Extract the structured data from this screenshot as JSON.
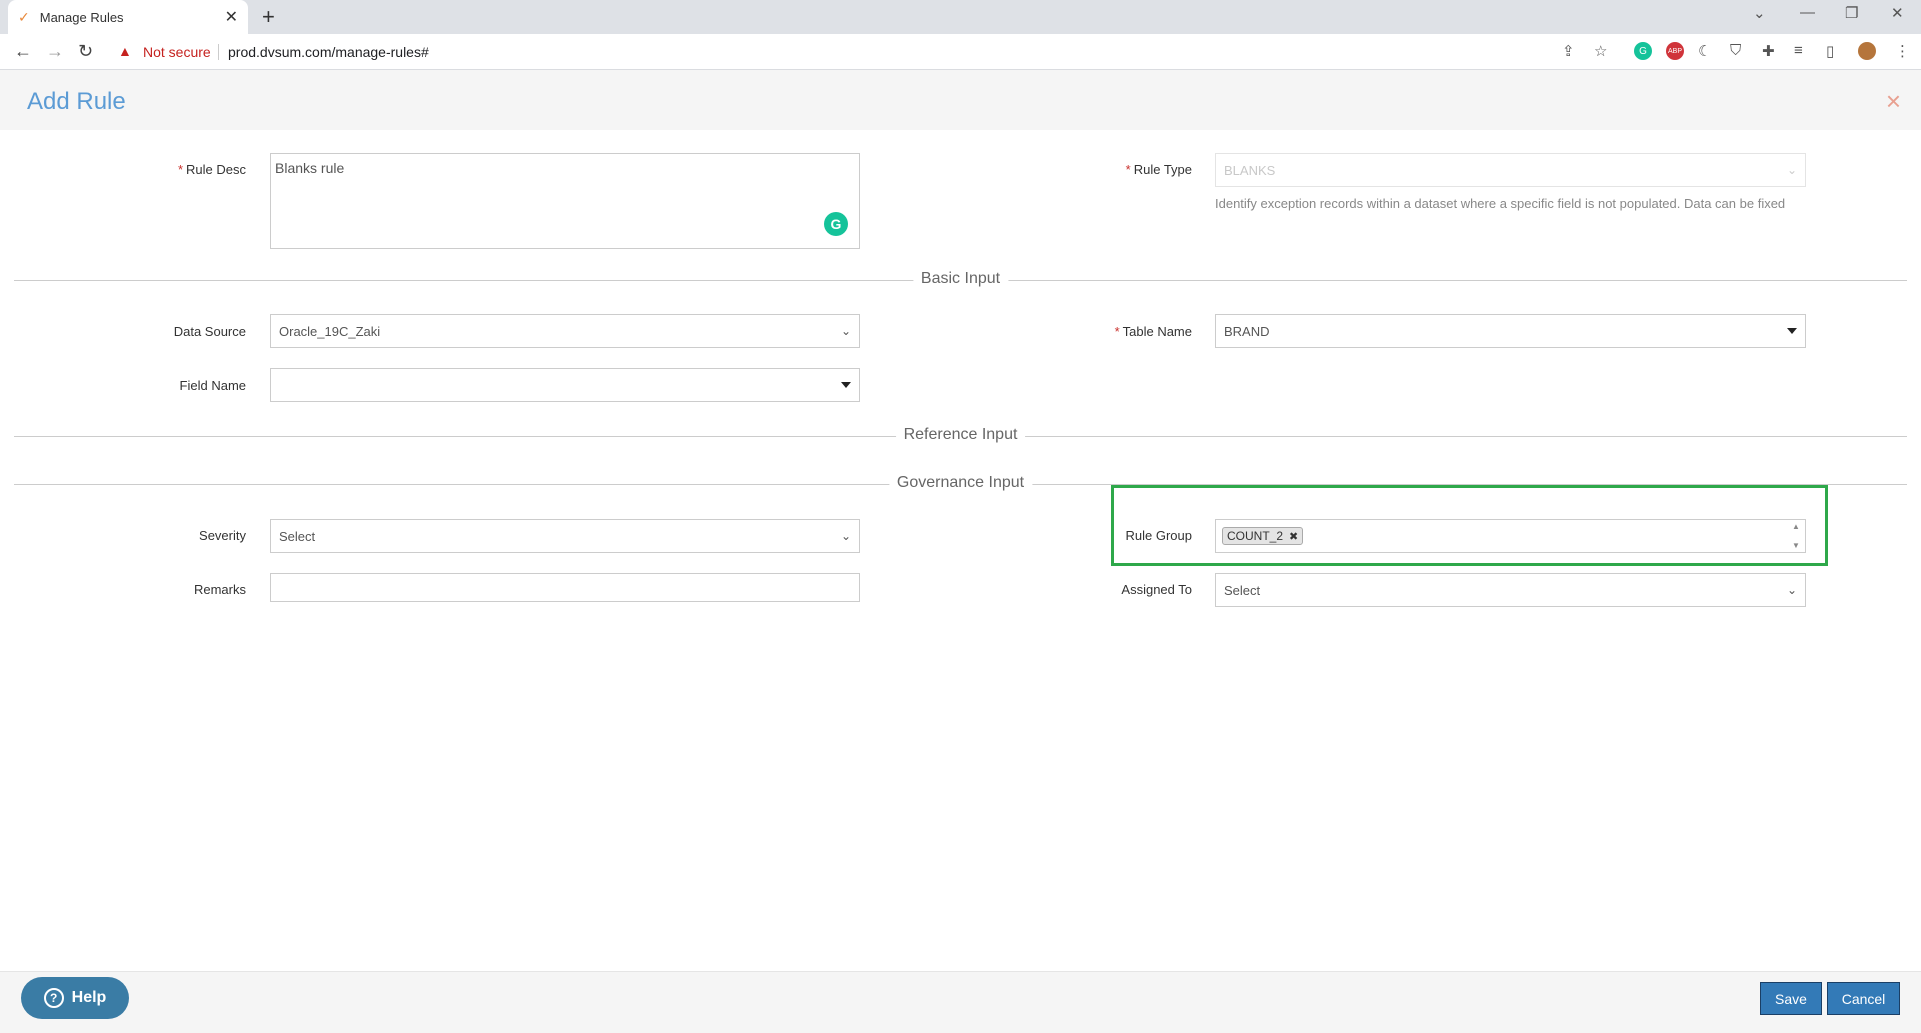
{
  "browser": {
    "tab_title": "Manage Rules",
    "new_tab": "+",
    "not_secure": "Not secure",
    "url": "prod.dvsum.com/manage-rules#"
  },
  "modal": {
    "title": "Add Rule",
    "close": "×"
  },
  "form": {
    "rule_desc_label": "Rule Desc",
    "rule_desc_value": "Blanks rule",
    "rule_type_label": "Rule Type",
    "rule_type_value": "BLANKS",
    "rule_type_help": "Identify exception records within a dataset where a specific field is not populated. Data can be fixed",
    "basic_input": "Basic Input",
    "data_source_label": "Data Source",
    "data_source_value": "Oracle_19C_Zaki",
    "table_name_label": "Table Name",
    "table_name_value": "BRAND",
    "field_name_label": "Field Name",
    "field_name_value": "",
    "reference_input": "Reference Input",
    "governance_input": "Governance Input",
    "severity_label": "Severity",
    "severity_value": "Select",
    "rule_group_label": "Rule Group",
    "rule_group_tag": "COUNT_2",
    "remarks_label": "Remarks",
    "remarks_value": "",
    "assigned_to_label": "Assigned To",
    "assigned_to_value": "Select"
  },
  "footer": {
    "help": "Help",
    "save": "Save",
    "cancel": "Cancel"
  },
  "colors": {
    "accent": "#5b9bd5",
    "primary_button": "#337ab7",
    "highlight": "#2ea84a",
    "required": "#c9302c"
  }
}
